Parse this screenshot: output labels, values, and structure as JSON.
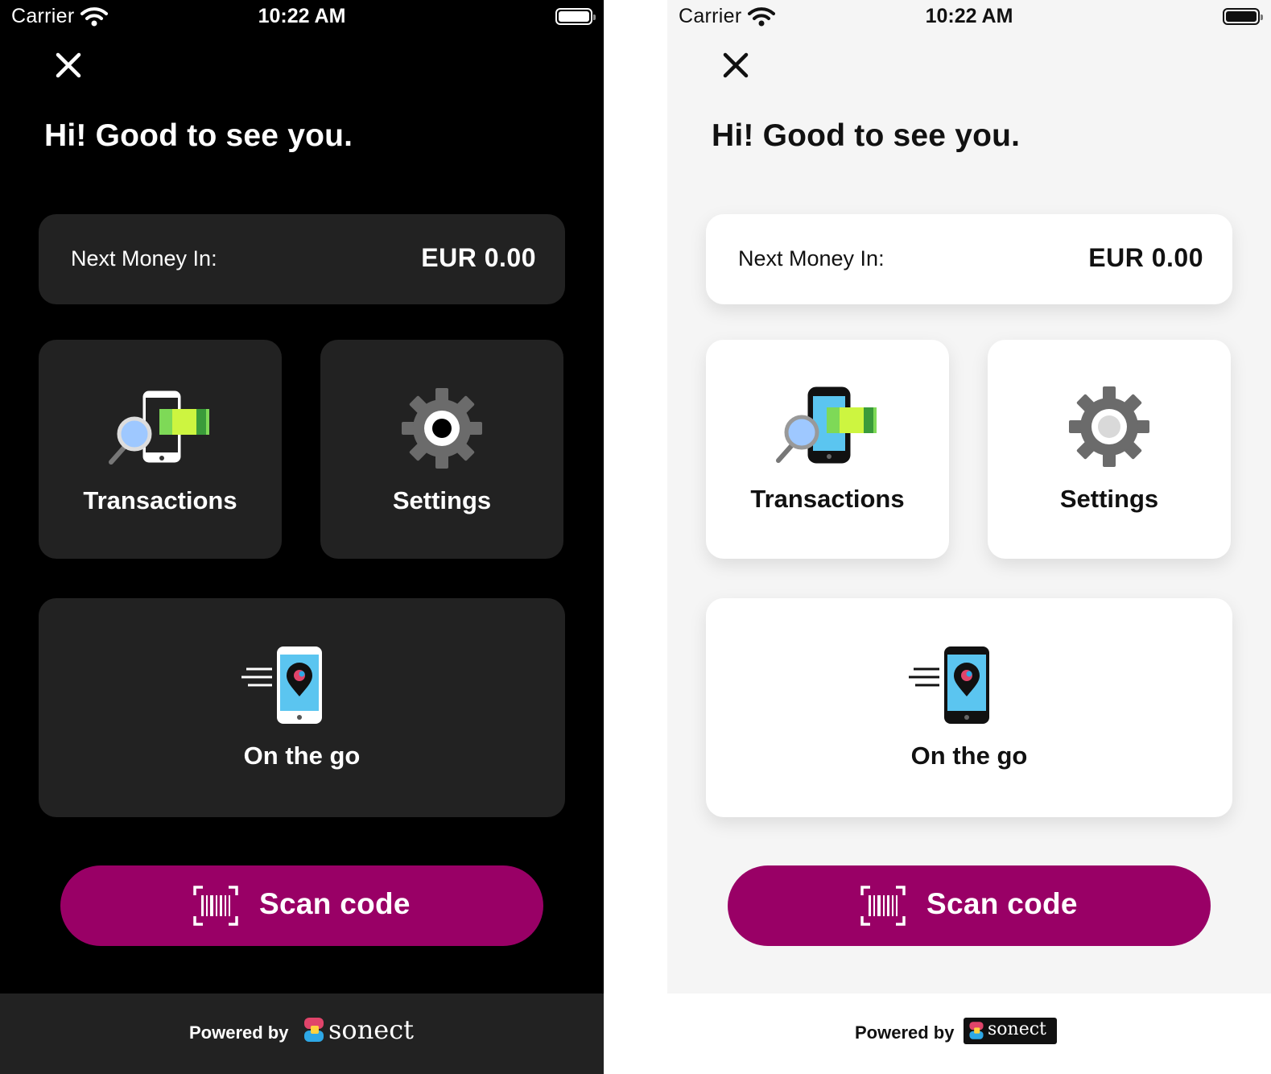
{
  "status_bar": {
    "carrier": "Carrier",
    "time": "10:22 AM",
    "icons": [
      "wifi-icon",
      "battery-icon"
    ]
  },
  "screen": {
    "greeting": "Hi! Good to see you.",
    "next_money": {
      "label": "Next Money In:",
      "value": "EUR 0.00"
    },
    "tiles": [
      {
        "label": "Transactions",
        "icon": "transactions-icon"
      },
      {
        "label": "Settings",
        "icon": "gear-icon"
      },
      {
        "label": "On the go",
        "icon": "on-the-go-icon"
      }
    ],
    "scan_button": {
      "label": "Scan code",
      "icon": "barcode-icon"
    },
    "footer": {
      "powered_by": "Powered by",
      "brand": "sonect"
    }
  },
  "themes": {
    "dark": {
      "background": "#000000",
      "card": "#222222",
      "text": "#ffffff",
      "gear": "#6b6b6b",
      "gear_hub": "#ffffff"
    },
    "light": {
      "background": "#f5f5f5",
      "card": "#ffffff",
      "text": "#111111",
      "gear": "#6b6b6b",
      "gear_hub": "#d9d9d9"
    },
    "accent": "#990066",
    "money_green": "#7ed957"
  }
}
